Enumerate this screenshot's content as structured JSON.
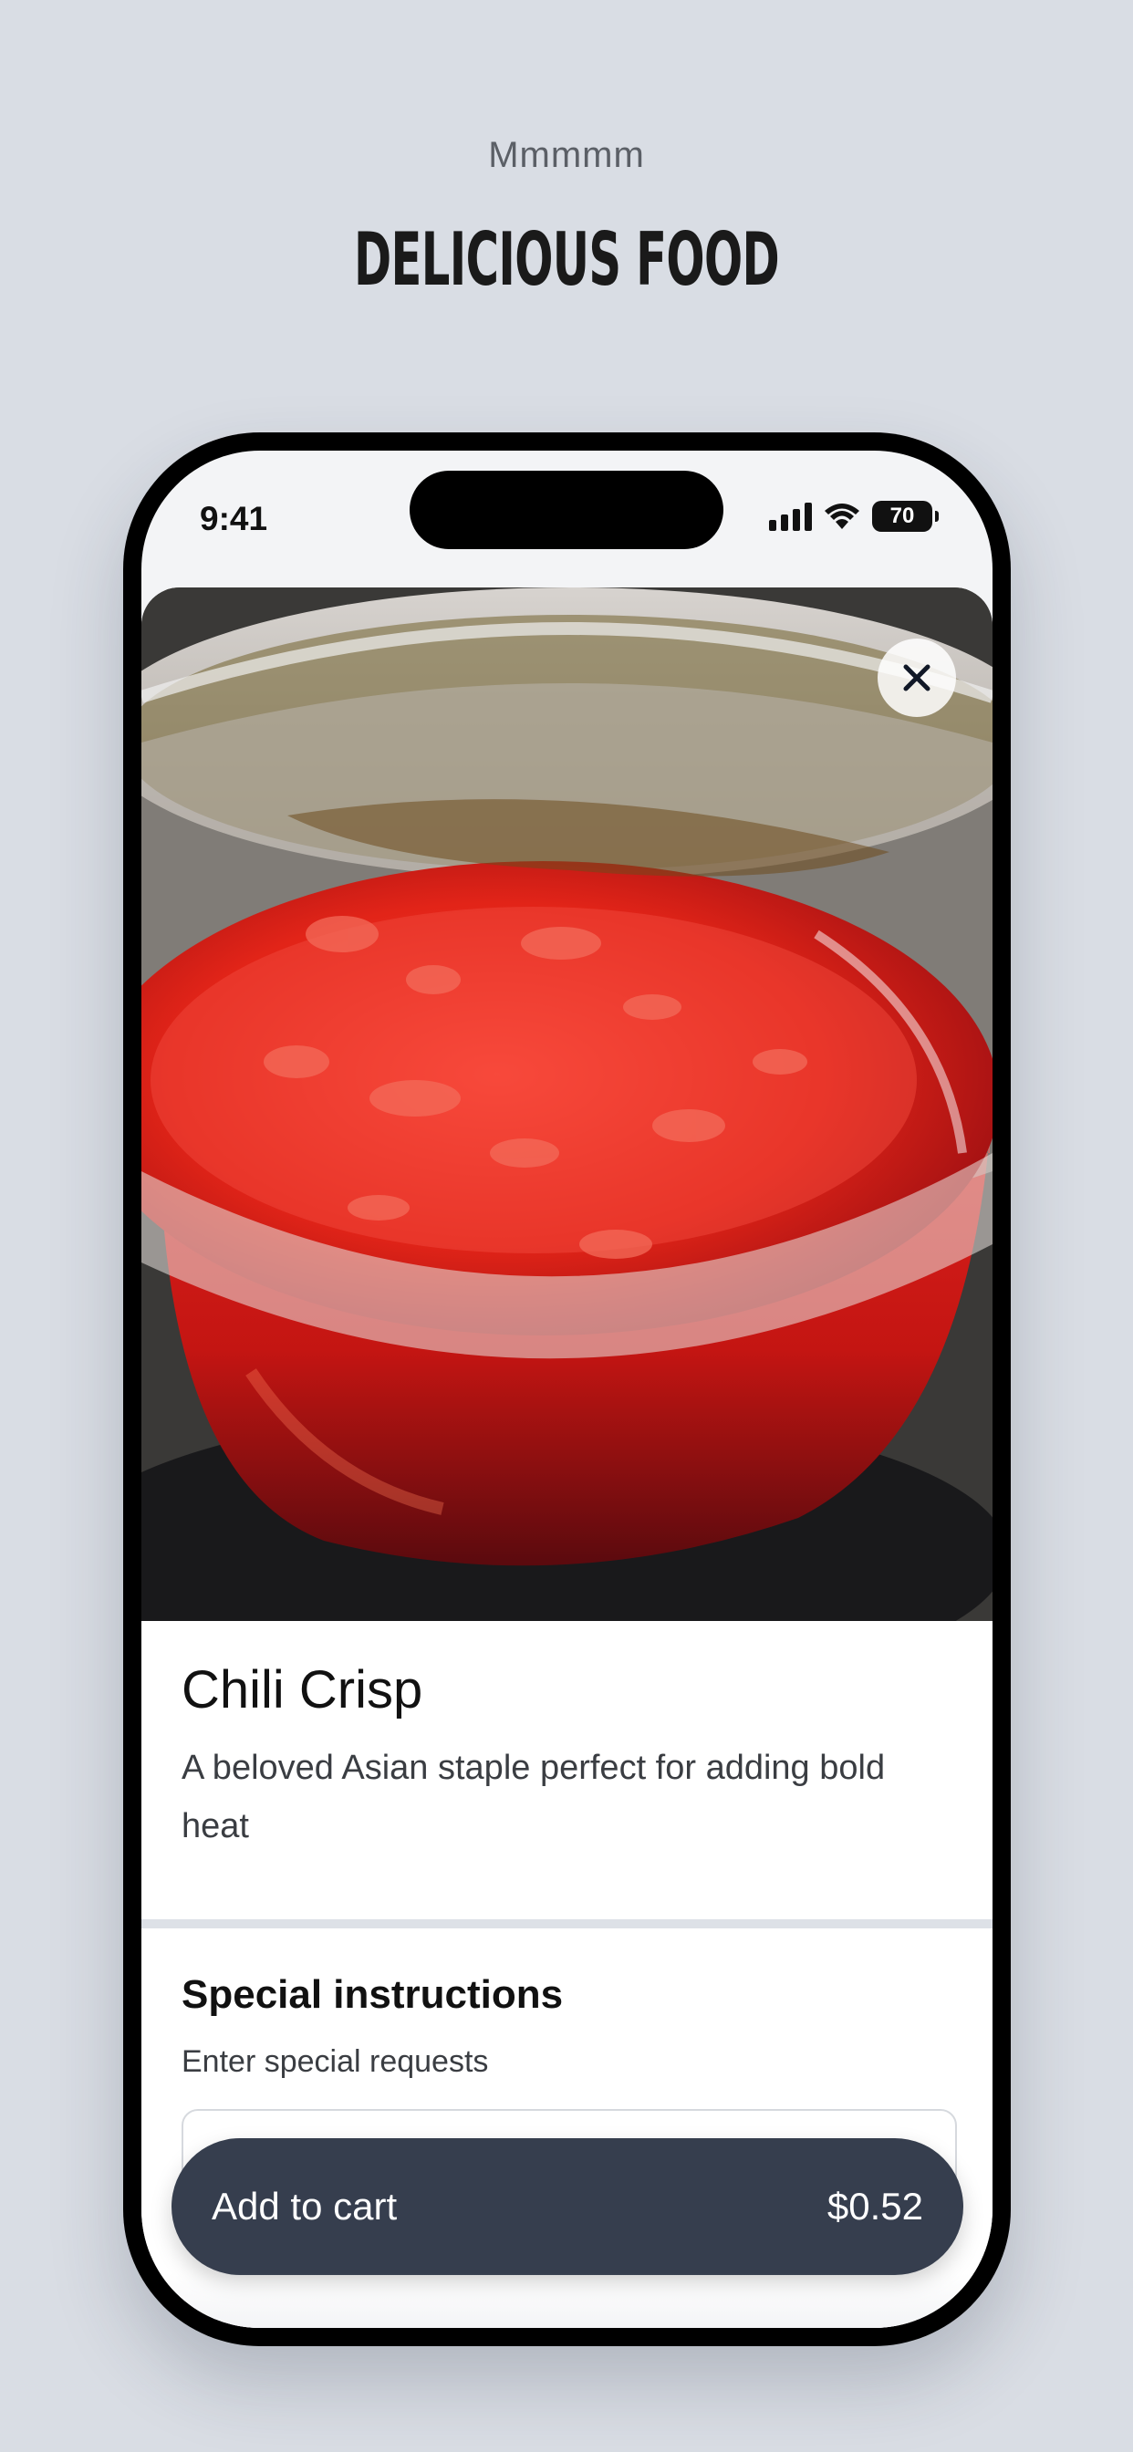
{
  "promo": {
    "subtitle": "Mmmmm",
    "title": "DELICIOUS FOOD"
  },
  "status_bar": {
    "time": "9:41",
    "battery": "70"
  },
  "product": {
    "image_icon": "chili-crisp-photo",
    "name": "Chili Crisp",
    "description": "A beloved Asian staple perfect for adding bold heat"
  },
  "instructions": {
    "title": "Special instructions",
    "subtitle": "Enter special requests",
    "input_value": ""
  },
  "cart_button": {
    "label": "Add to cart",
    "price": "$0.52"
  },
  "colors": {
    "page_background": "#d9dde4",
    "button_background": "#363e4e",
    "sauce_red": "#e02020"
  }
}
